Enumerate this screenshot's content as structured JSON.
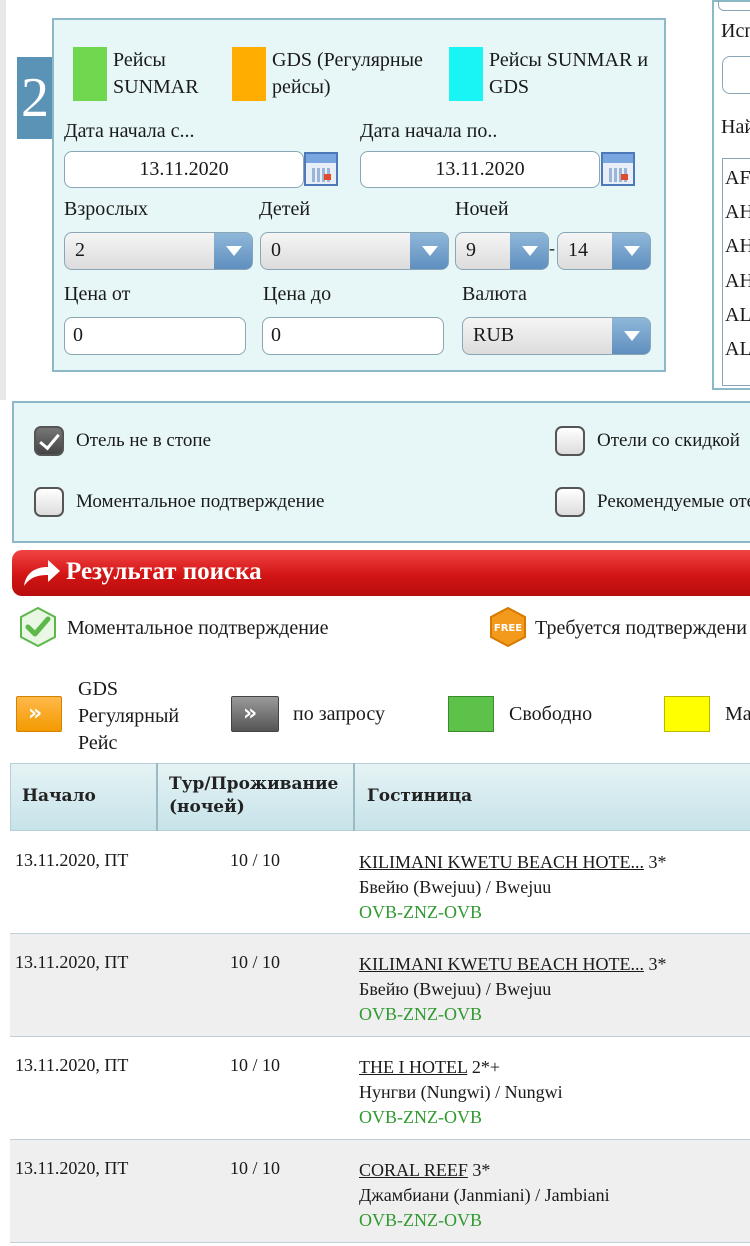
{
  "step_number": "2",
  "legend": [
    {
      "label": "Рейсы SUNMAR",
      "color": "#6fd84e"
    },
    {
      "label": "GDS (Регулярные рейсы)",
      "color": "#ffad00"
    },
    {
      "label": "Рейсы SUNMAR и GDS",
      "color": "#19f5f5"
    }
  ],
  "form": {
    "date_from_label": "Дата начала с...",
    "date_to_label": "Дата начала по..",
    "date_from": "13.11.2020",
    "date_to": "13.11.2020",
    "adults_label": "Взрослых",
    "children_label": "Детей",
    "nights_label": "Ночей",
    "adults": "2",
    "children": "0",
    "nights_from": "9",
    "nights_dash": "-",
    "nights_to": "14",
    "price_from_label": "Цена от",
    "price_to_label": "Цена до",
    "currency_label": "Валюта",
    "price_from": "0",
    "price_to": "0",
    "currency": "RUB"
  },
  "right_panel": {
    "label1": "Исп",
    "label2": "Най",
    "list": [
      "AF",
      "AH",
      "AH",
      "AH",
      "AL",
      "AL"
    ]
  },
  "filters": {
    "not_in_stop": "Отель не в стопе",
    "discount": "Отели со скидкой",
    "instant": "Моментальное подтверждение",
    "recommended": "Рекомендуемые оте"
  },
  "results": {
    "title": "Результат поиска",
    "legend_instant": "Моментальное подтверждение",
    "legend_request_confirm": "Требуется подтверждени",
    "free_badge_text": "FREE",
    "legend_gds": "GDS Регулярный Рейс",
    "legend_gds_lines": [
      "GDS",
      "Регулярный",
      "Рейс"
    ],
    "legend_on_request": "по запросу",
    "legend_available": "Свободно",
    "legend_few": "Ма"
  },
  "table": {
    "headers": {
      "start": "Начало",
      "tour": "Тур/Проживание (ночей)",
      "tour_line1": "Тур/Проживание",
      "tour_line2": "(ночей)",
      "hotel": "Гостиница"
    },
    "rows": [
      {
        "date": "13.11.2020, ПТ",
        "nights": "10 / 10",
        "hotel": "KILIMANI KWETU BEACH HOTE...",
        "stars": " 3*",
        "place": "Бвейю (Bwejuu) / Bwejuu",
        "route": "OVB-ZNZ-OVB"
      },
      {
        "date": "13.11.2020, ПТ",
        "nights": "10 / 10",
        "hotel": "KILIMANI KWETU BEACH HOTE...",
        "stars": " 3*",
        "place": "Бвейю (Bwejuu) / Bwejuu",
        "route": "OVB-ZNZ-OVB"
      },
      {
        "date": "13.11.2020, ПТ",
        "nights": "10 / 10",
        "hotel": "THE I HOTEL",
        "stars": " 2*+",
        "place": "Нунгви (Nungwi) / Nungwi",
        "route": "OVB-ZNZ-OVB"
      },
      {
        "date": "13.11.2020, ПТ",
        "nights": "10 / 10",
        "hotel": "CORAL REEF",
        "stars": " 3*",
        "place": "Джамбиани (Janmiani) / Jambiani",
        "route": "OVB-ZNZ-OVB"
      }
    ]
  }
}
